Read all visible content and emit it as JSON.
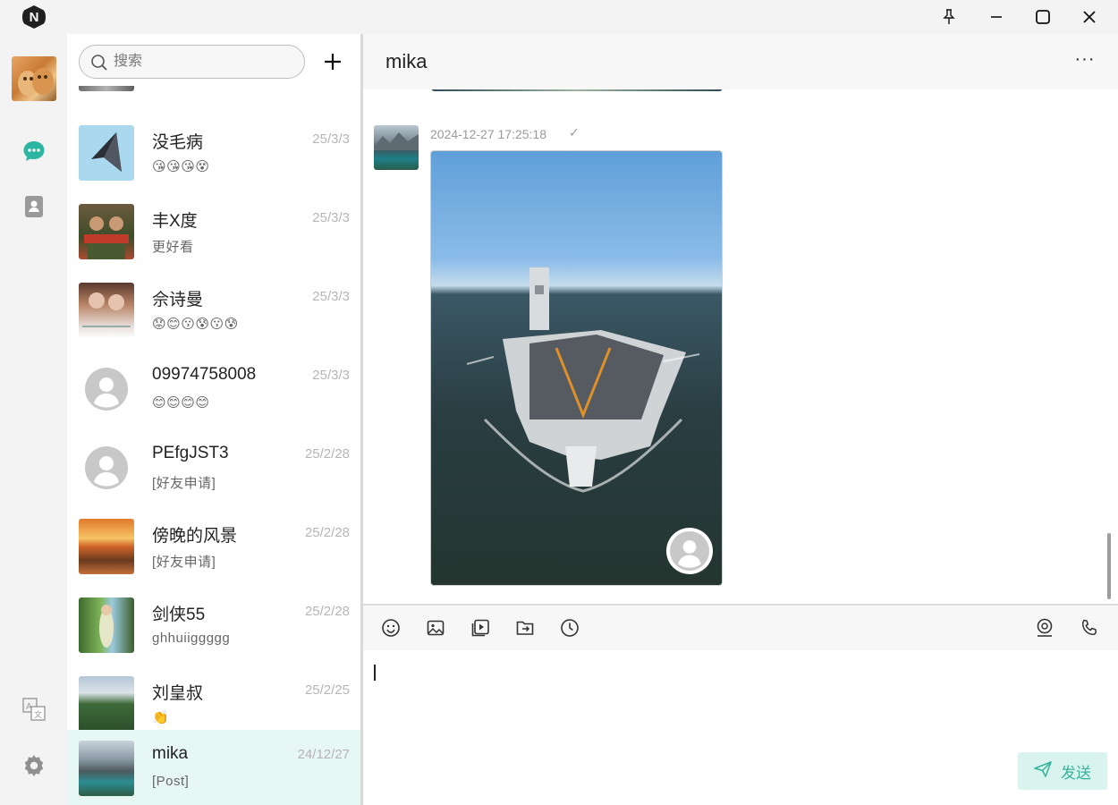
{
  "titlebar": {
    "logo_letter": "N",
    "buttons": [
      "pin-icon",
      "minimize-icon",
      "maximize-icon",
      "close-icon"
    ]
  },
  "rail": {
    "items": [
      {
        "icon": "chat-bubble-icon",
        "active": true,
        "color": "#2cb5a0"
      },
      {
        "icon": "contacts-book-icon",
        "active": false,
        "color": "#9a9a9a"
      }
    ],
    "bottom": [
      "translate-icon",
      "gear-icon"
    ]
  },
  "search": {
    "placeholder": "搜索"
  },
  "contacts": [
    {
      "name": "没毛病",
      "date": "25/3/3",
      "preview": "😘😘😘😵"
    },
    {
      "name": "丰X度",
      "date": "25/3/3",
      "preview": "更好看"
    },
    {
      "name": "佘诗曼",
      "date": "25/3/3",
      "preview": "😟😊😗😰😗😰"
    },
    {
      "name": "09974758008",
      "date": "25/3/3",
      "preview": "😊😊😊😊"
    },
    {
      "name": "PEfgJST3",
      "date": "25/2/28",
      "preview": "[好友申请]"
    },
    {
      "name": "傍晚的风景",
      "date": "25/2/28",
      "preview": "[好友申请]"
    },
    {
      "name": "剑侠55",
      "date": "25/2/28",
      "preview": "ghhuiiggggg"
    },
    {
      "name": "刘皇叔",
      "date": "25/2/25",
      "preview": "👏"
    },
    {
      "name": "mika",
      "date": "24/12/27",
      "preview": "[Post]",
      "active": true
    }
  ],
  "chat": {
    "title": "mika",
    "more": "···",
    "message": {
      "time": "2024-12-27 17:25:18",
      "status": "✓"
    }
  },
  "toolbar": {
    "left": [
      "emoji-icon",
      "image-icon",
      "video-icon",
      "file-icon",
      "history-icon"
    ],
    "right": [
      "video-call-icon",
      "phone-icon"
    ]
  },
  "composer": {
    "value": "",
    "send_label": "发送"
  },
  "colors": {
    "accent": "#2cb5a0",
    "active_row": "#e6f7f4",
    "send_bg": "#d9f3ee"
  }
}
